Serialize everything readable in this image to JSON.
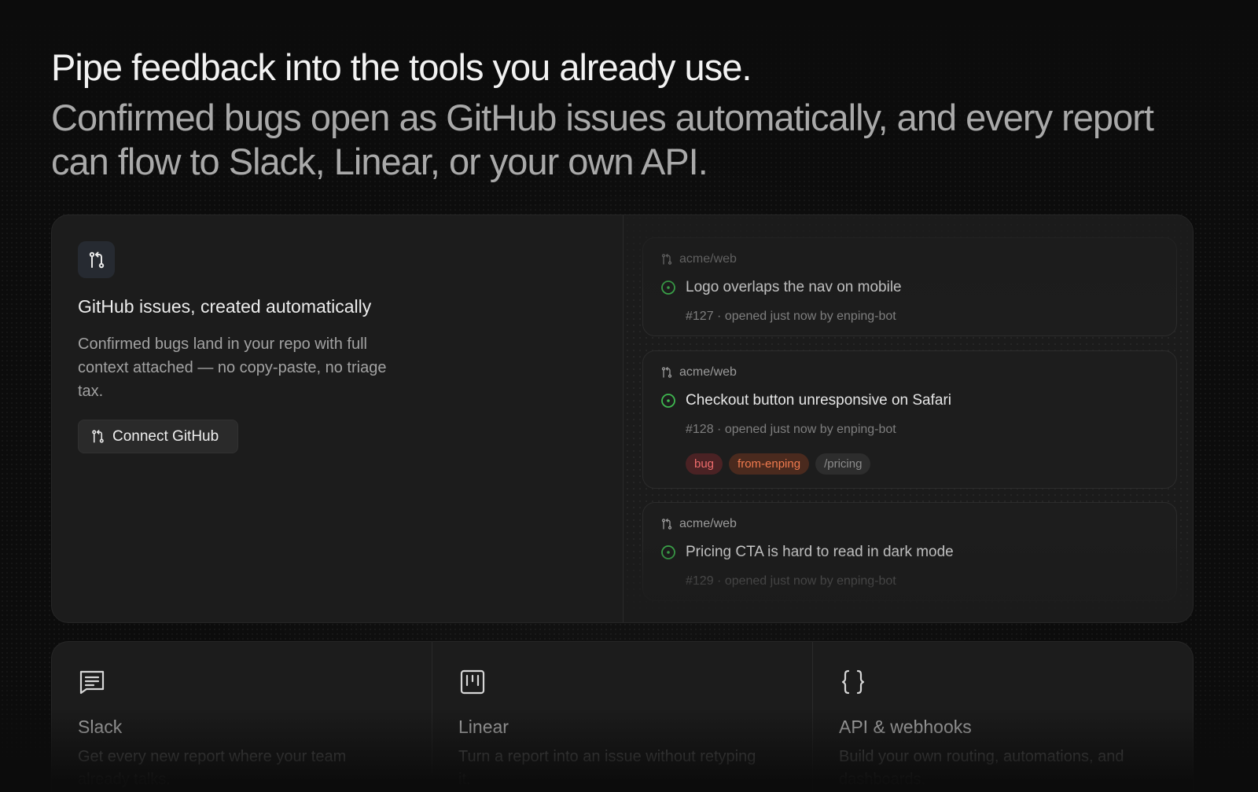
{
  "headline": {
    "title": "Pipe feedback into the tools you already use.",
    "subtitle": "Confirmed bugs open as GitHub issues automatically, and every report can flow to Slack, Linear, or your own API."
  },
  "github_card": {
    "icon": "git-pull-request-icon",
    "title": "GitHub issues, created automatically",
    "description": "Confirmed bugs land in your repo with full context attached — no copy-paste, no triage tax.",
    "button_label": "Connect GitHub"
  },
  "issues": [
    {
      "repo": "acme/web",
      "title": "Logo overlaps the nav on mobile",
      "meta": "#127 · opened just now by enping-bot",
      "labels": []
    },
    {
      "repo": "acme/web",
      "title": "Checkout button unresponsive on Safari",
      "meta": "#128 · opened just now by enping-bot",
      "labels": [
        "bug",
        "from-enping",
        "/pricing"
      ]
    },
    {
      "repo": "acme/web",
      "title": "Pricing CTA is hard to read in dark mode",
      "meta": "#129 · opened just now by enping-bot",
      "labels": []
    }
  ],
  "integrations": [
    {
      "icon": "chat-icon",
      "name": "Slack",
      "description": "Get every new report where your team already talks."
    },
    {
      "icon": "kanban-icon",
      "name": "Linear",
      "description": "Turn a report into an issue without retyping it."
    },
    {
      "icon": "braces-icon",
      "name": "API & webhooks",
      "description": "Build your own routing, automations, and dashboards."
    }
  ],
  "colors": {
    "open_issue_green": "#3fb950",
    "label_bug": "#ee6c6c",
    "label_enping": "#f07a4e"
  }
}
